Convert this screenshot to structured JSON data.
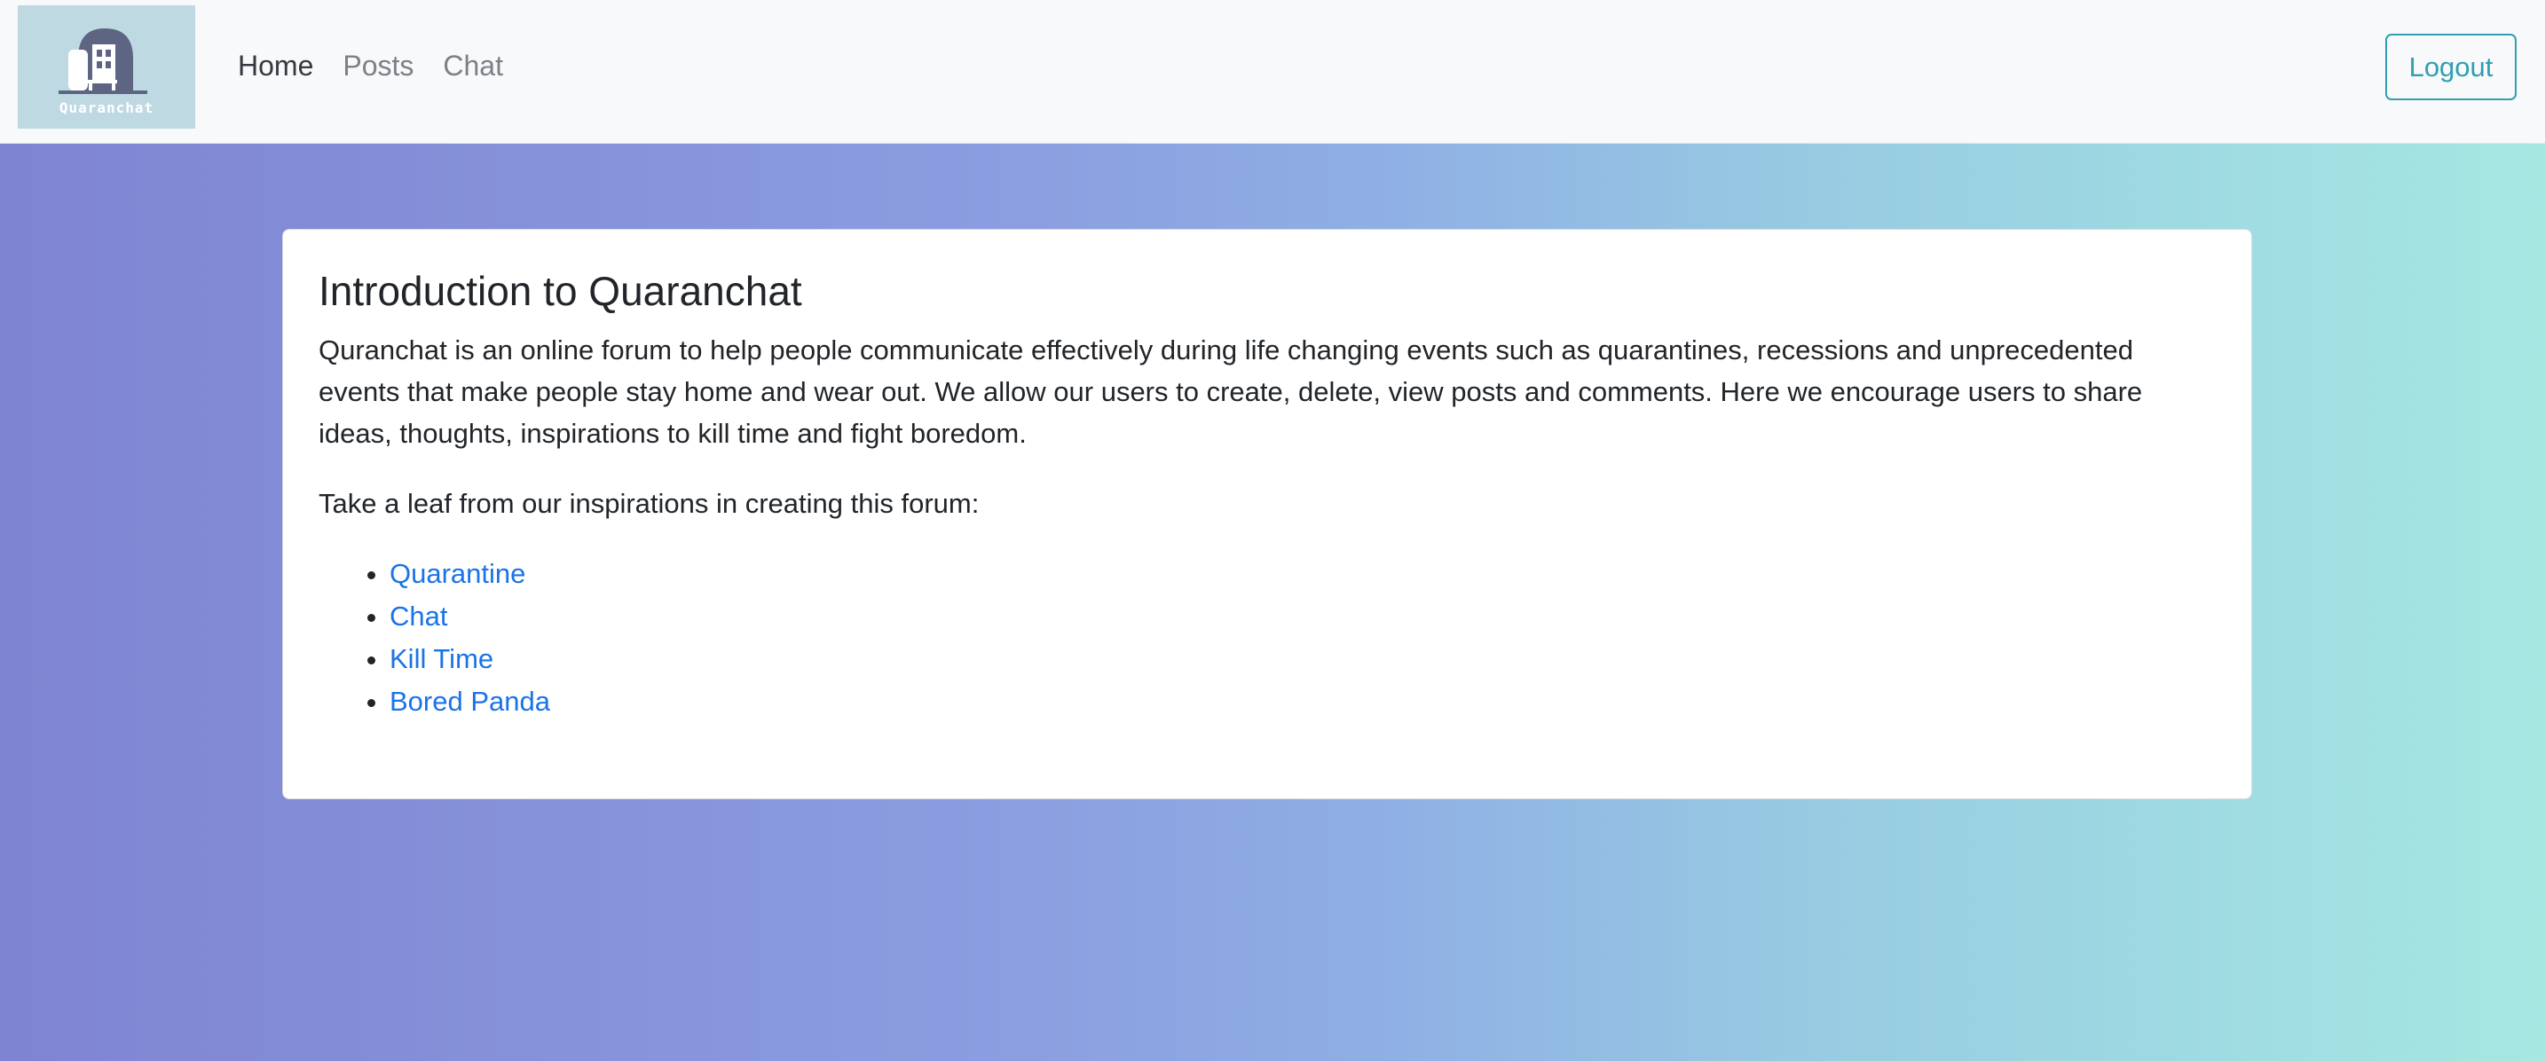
{
  "nav": {
    "logo_text": "Quaranchat",
    "items": [
      {
        "label": "Home",
        "active": true
      },
      {
        "label": "Posts",
        "active": false
      },
      {
        "label": "Chat",
        "active": false
      }
    ],
    "logout_label": "Logout"
  },
  "card": {
    "title": "Introduction to Quaranchat",
    "paragraph1": "Quranchat is an online forum to help people communicate effectively during life changing events such as quarantines, recessions and unprecedented events that make people stay home and wear out. We allow our users to create, delete, view posts and comments. Here we encourage users to share ideas, thoughts, inspirations to kill time and fight boredom.",
    "paragraph2": "Take a leaf from our inspirations in creating this forum:",
    "links": [
      "Quarantine",
      "Chat",
      "Kill Time",
      "Bored Panda"
    ]
  },
  "colors": {
    "link": "#1a73e8",
    "logout": "#2f9fb1",
    "navbar_bg": "#f8f9fa",
    "gradient_start": "#7f84d2",
    "gradient_end": "#a5e8e2"
  }
}
